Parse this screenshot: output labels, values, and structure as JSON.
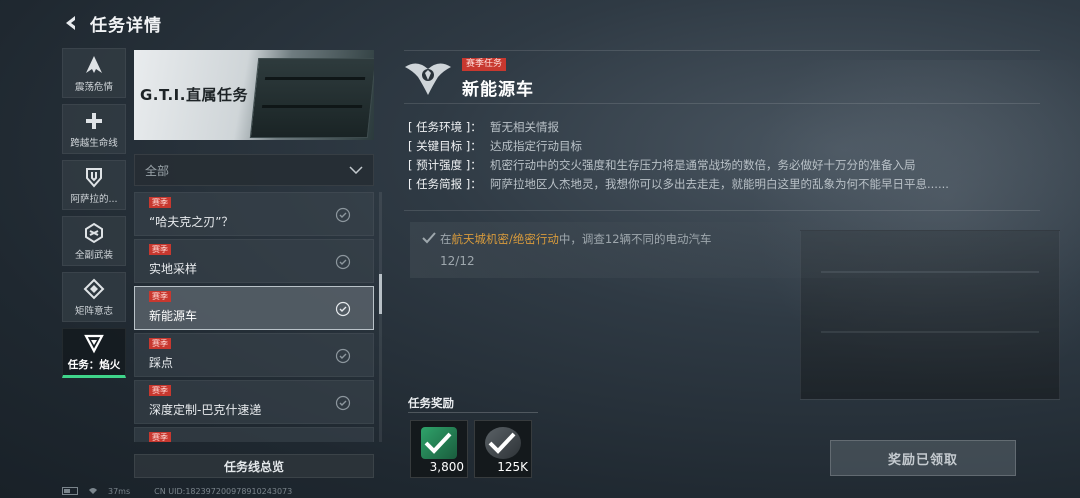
{
  "header": {
    "title": "任务详情"
  },
  "rail": {
    "items": [
      {
        "label": "震荡危情",
        "icon": "a-shard-icon"
      },
      {
        "label": "跨越生命线",
        "icon": "plus-icon"
      },
      {
        "label": "阿萨拉的...",
        "icon": "shield-icon"
      },
      {
        "label": "全副武装",
        "icon": "hexagon-knot-icon"
      },
      {
        "label": "矩阵意志",
        "icon": "diamond-arrows-icon"
      },
      {
        "label": "任务：焰火",
        "icon": "triangle-mark-icon",
        "active": true
      }
    ]
  },
  "banner": {
    "title": "G.T.I.直属任务"
  },
  "filter": {
    "label": "全部"
  },
  "tasks": [
    {
      "tag": "赛季",
      "name": "“哈夫克之刃”？"
    },
    {
      "tag": "赛季",
      "name": "实地采样"
    },
    {
      "tag": "赛季",
      "name": "新能源车",
      "selected": true
    },
    {
      "tag": "赛季",
      "name": "踩点"
    },
    {
      "tag": "赛季",
      "name": "深度定制-巴克什速递"
    },
    {
      "tag": "赛季",
      "name": ""
    }
  ],
  "overview_button": "任务线总览",
  "statusbar": {
    "ping": "37ms",
    "uid": "CN UID:182397200978910243073"
  },
  "mission": {
    "tag": "赛季任务",
    "title": "新能源车",
    "info": [
      {
        "key": "[ 任务环境 ]：",
        "value": "暂无相关情报"
      },
      {
        "key": "[ 关键目标 ]：",
        "value": "达成指定行动目标"
      },
      {
        "key": "[ 预计强度 ]：",
        "value": "机密行动中的交火强度和生存压力将是通常战场的数倍，务必做好十万分的准备入局"
      },
      {
        "key": "[ 任务简报 ]：",
        "value": "阿萨拉地区人杰地灵，我想你可以多出去走走，就能明白这里的乱象为何不能早日平息......"
      }
    ],
    "objective": {
      "prefix": "在",
      "highlight": "航天城机密/绝密行动",
      "suffix": "中，调查12辆不同的电动汽车",
      "progress": "12/12"
    }
  },
  "rewards": {
    "title": "任务奖励",
    "items": [
      {
        "qty": "3,800",
        "icon": "green-badge-icon"
      },
      {
        "qty": "125K",
        "icon": "coin-icon"
      }
    ]
  },
  "claim_button": "奖励已领取",
  "colors": {
    "accent_green": "#3fd48a",
    "season_red": "#c8382f",
    "highlight_orange": "#d89b3c"
  }
}
